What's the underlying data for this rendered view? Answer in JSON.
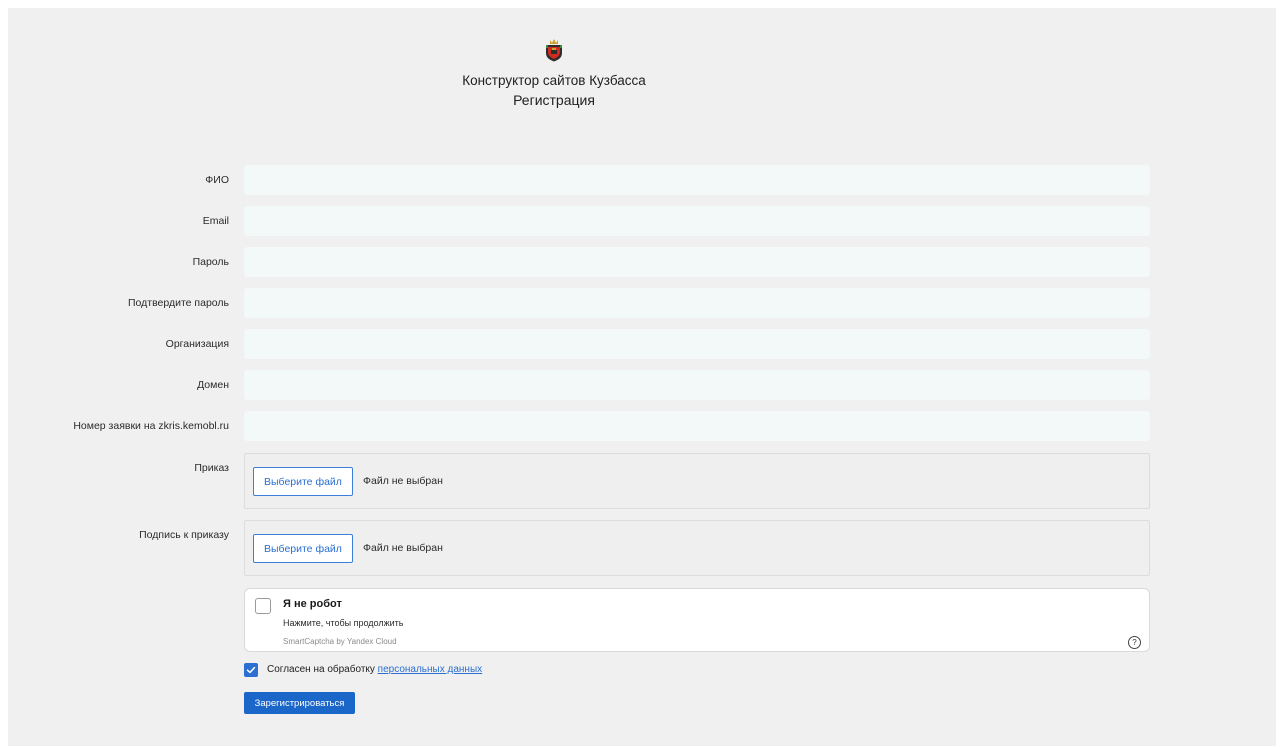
{
  "header": {
    "emblem_icon": "kuzbass-coat-of-arms-icon",
    "site_title": "Конструктор сайтов Кузбасса",
    "page_title": "Регистрация"
  },
  "form": {
    "fields": [
      {
        "label": "ФИО",
        "value": "",
        "placeholder": ""
      },
      {
        "label": "Email",
        "value": "",
        "placeholder": ""
      },
      {
        "label": "Пароль",
        "value": "",
        "placeholder": ""
      },
      {
        "label": "Подтвердите пароль",
        "value": "",
        "placeholder": ""
      },
      {
        "label": "Организация",
        "value": "",
        "placeholder": ""
      },
      {
        "label": "Домен",
        "value": "",
        "placeholder": ""
      },
      {
        "label": "Номер заявки на zkris.kemobl.ru",
        "value": "",
        "placeholder": ""
      }
    ],
    "files": [
      {
        "label": "Приказ",
        "button_label": "Выберите файл",
        "status": "Файл не выбран"
      },
      {
        "label": "Подпись к приказу",
        "button_label": "Выберите файл",
        "status": "Файл не выбран"
      }
    ]
  },
  "captcha": {
    "title": "Я не робот",
    "subtitle": "Нажмите, чтобы продолжить",
    "brand": "SmartCaptcha by Yandex Cloud",
    "help_symbol": "?",
    "checked": false
  },
  "consent": {
    "checked": true,
    "text": "Согласен на обработку ",
    "link_text": "персональных данных"
  },
  "submit_label": "Зарегистрироваться",
  "colors": {
    "accent": "#2a6fd1",
    "page_bg": "#f0f0f0",
    "input_bg": "#f3f8f8"
  }
}
